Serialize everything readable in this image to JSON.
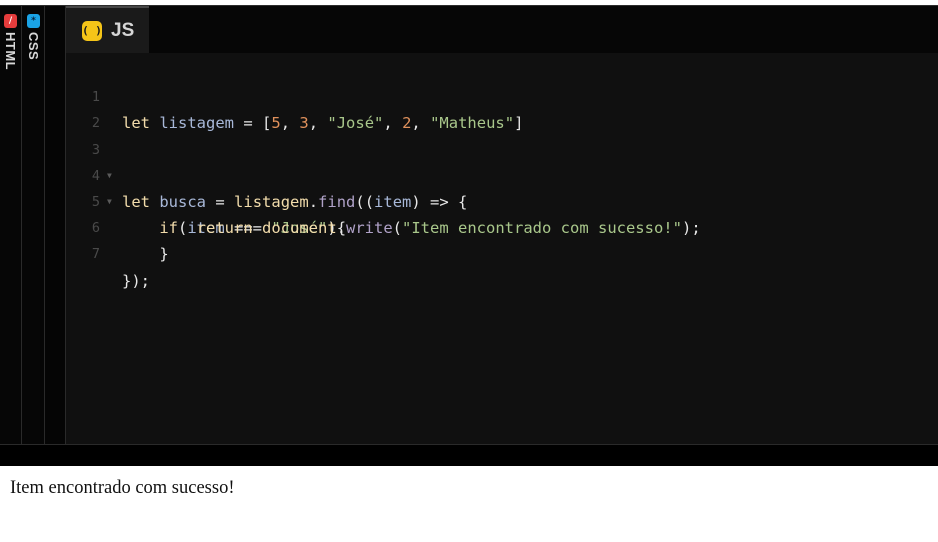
{
  "side_tabs": [
    {
      "label": "HTML",
      "icon": "html-icon"
    },
    {
      "label": "CSS",
      "icon": "css-icon"
    }
  ],
  "active_tab": {
    "label": "JS",
    "icon": "js-icon"
  },
  "code": {
    "line_numbers": [
      "1",
      "2",
      "3",
      "4",
      "5",
      "6",
      "7"
    ],
    "lines": [
      "let listagem = [5, 3, \"José\", 2, \"Matheus\"]",
      "",
      "let busca = listagem.find((item) => {",
      "    if(item === \"José\"){",
      "        return document.write(\"Item encontrado com sucesso!\");",
      "    }",
      "});"
    ]
  },
  "output": {
    "text": "Item encontrado com sucesso!"
  },
  "colors": {
    "keyword": "#f2dcab",
    "identifier": "#a8b8d8",
    "number": "#e0915c",
    "string": "#a9c78b",
    "method": "#b0a2c8",
    "js_badge": "#f5c518",
    "html_badge": "#e53c3c",
    "css_badge": "#1aa3e6"
  }
}
